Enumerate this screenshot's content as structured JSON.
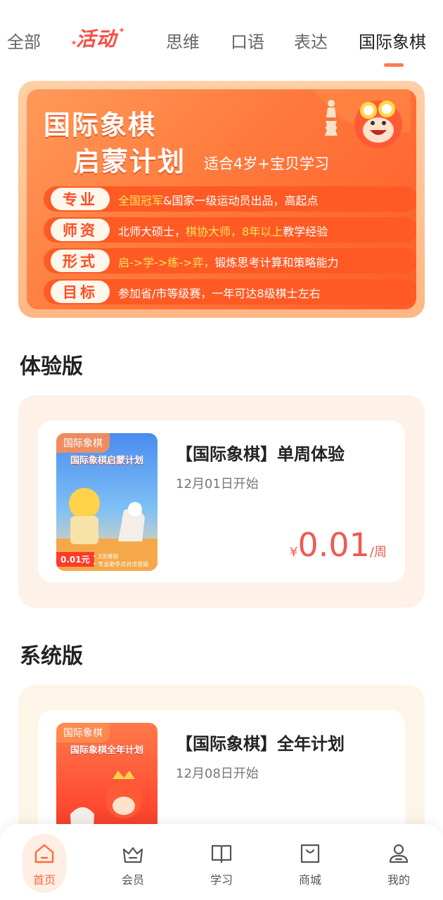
{
  "tabs": [
    {
      "label": "全部",
      "active": false
    },
    {
      "label": "活动",
      "active": false,
      "style": "promo"
    },
    {
      "label": "思维",
      "active": false
    },
    {
      "label": "口语",
      "active": false
    },
    {
      "label": "表达",
      "active": false
    },
    {
      "label": "国际象棋",
      "active": true
    }
  ],
  "banner": {
    "title_line1": "国际象棋",
    "title_line2": "启蒙计划",
    "subtitle": "适合4岁+宝贝学习",
    "rows": [
      {
        "tag": "专业",
        "parts": [
          {
            "t": "全国冠军",
            "hl": true
          },
          {
            "t": "&国家一级运动员出品，高起点",
            "hl": false
          }
        ]
      },
      {
        "tag": "师资",
        "parts": [
          {
            "t": "北师大硕士，",
            "hl": false
          },
          {
            "t": "棋协大师，8年以上",
            "hl": true
          },
          {
            "t": "教学经验",
            "hl": false
          }
        ]
      },
      {
        "tag": "形式",
        "parts": [
          {
            "t": "启->学->练->弈，",
            "hl": true
          },
          {
            "t": "锻炼思考计算和策略能力",
            "hl": false
          }
        ]
      },
      {
        "tag": "目标",
        "parts": [
          {
            "t": "参加省/市等级赛，一年可达8级棋士左右",
            "hl": false
          }
        ]
      }
    ],
    "accent": "#ff6a30"
  },
  "sections": {
    "trial": {
      "heading": "体验版",
      "card": {
        "cover_badge": "国际象棋",
        "cover_title": "国际象棋启蒙计划",
        "cover_price": "0.01元",
        "cover_note1": "• 3次体验",
        "cover_note2": "• 专业助手点对点答疑",
        "title": "【国际象棋】单周体验",
        "date": "12月01日开始",
        "price_currency": "¥",
        "price_amount": "0.01",
        "price_unit": "/周"
      }
    },
    "system": {
      "heading": "系统版",
      "card": {
        "cover_badge": "国际象棋",
        "cover_title": "国际象棋全年计划",
        "title": "【国际象棋】全年计划",
        "date": "12月08日开始"
      }
    }
  },
  "bottom_nav": [
    {
      "label": "首页",
      "icon": "home-icon",
      "active": true
    },
    {
      "label": "会员",
      "icon": "crown-basket-icon",
      "active": false
    },
    {
      "label": "学习",
      "icon": "book-icon",
      "active": false
    },
    {
      "label": "商城",
      "icon": "shopping-bag-icon",
      "active": false
    },
    {
      "label": "我的",
      "icon": "user-icon",
      "active": false
    }
  ],
  "colors": {
    "price": "#f05a4f",
    "active_nav": "#ff6a3d",
    "tab_indicator": "#ff7a4d"
  }
}
